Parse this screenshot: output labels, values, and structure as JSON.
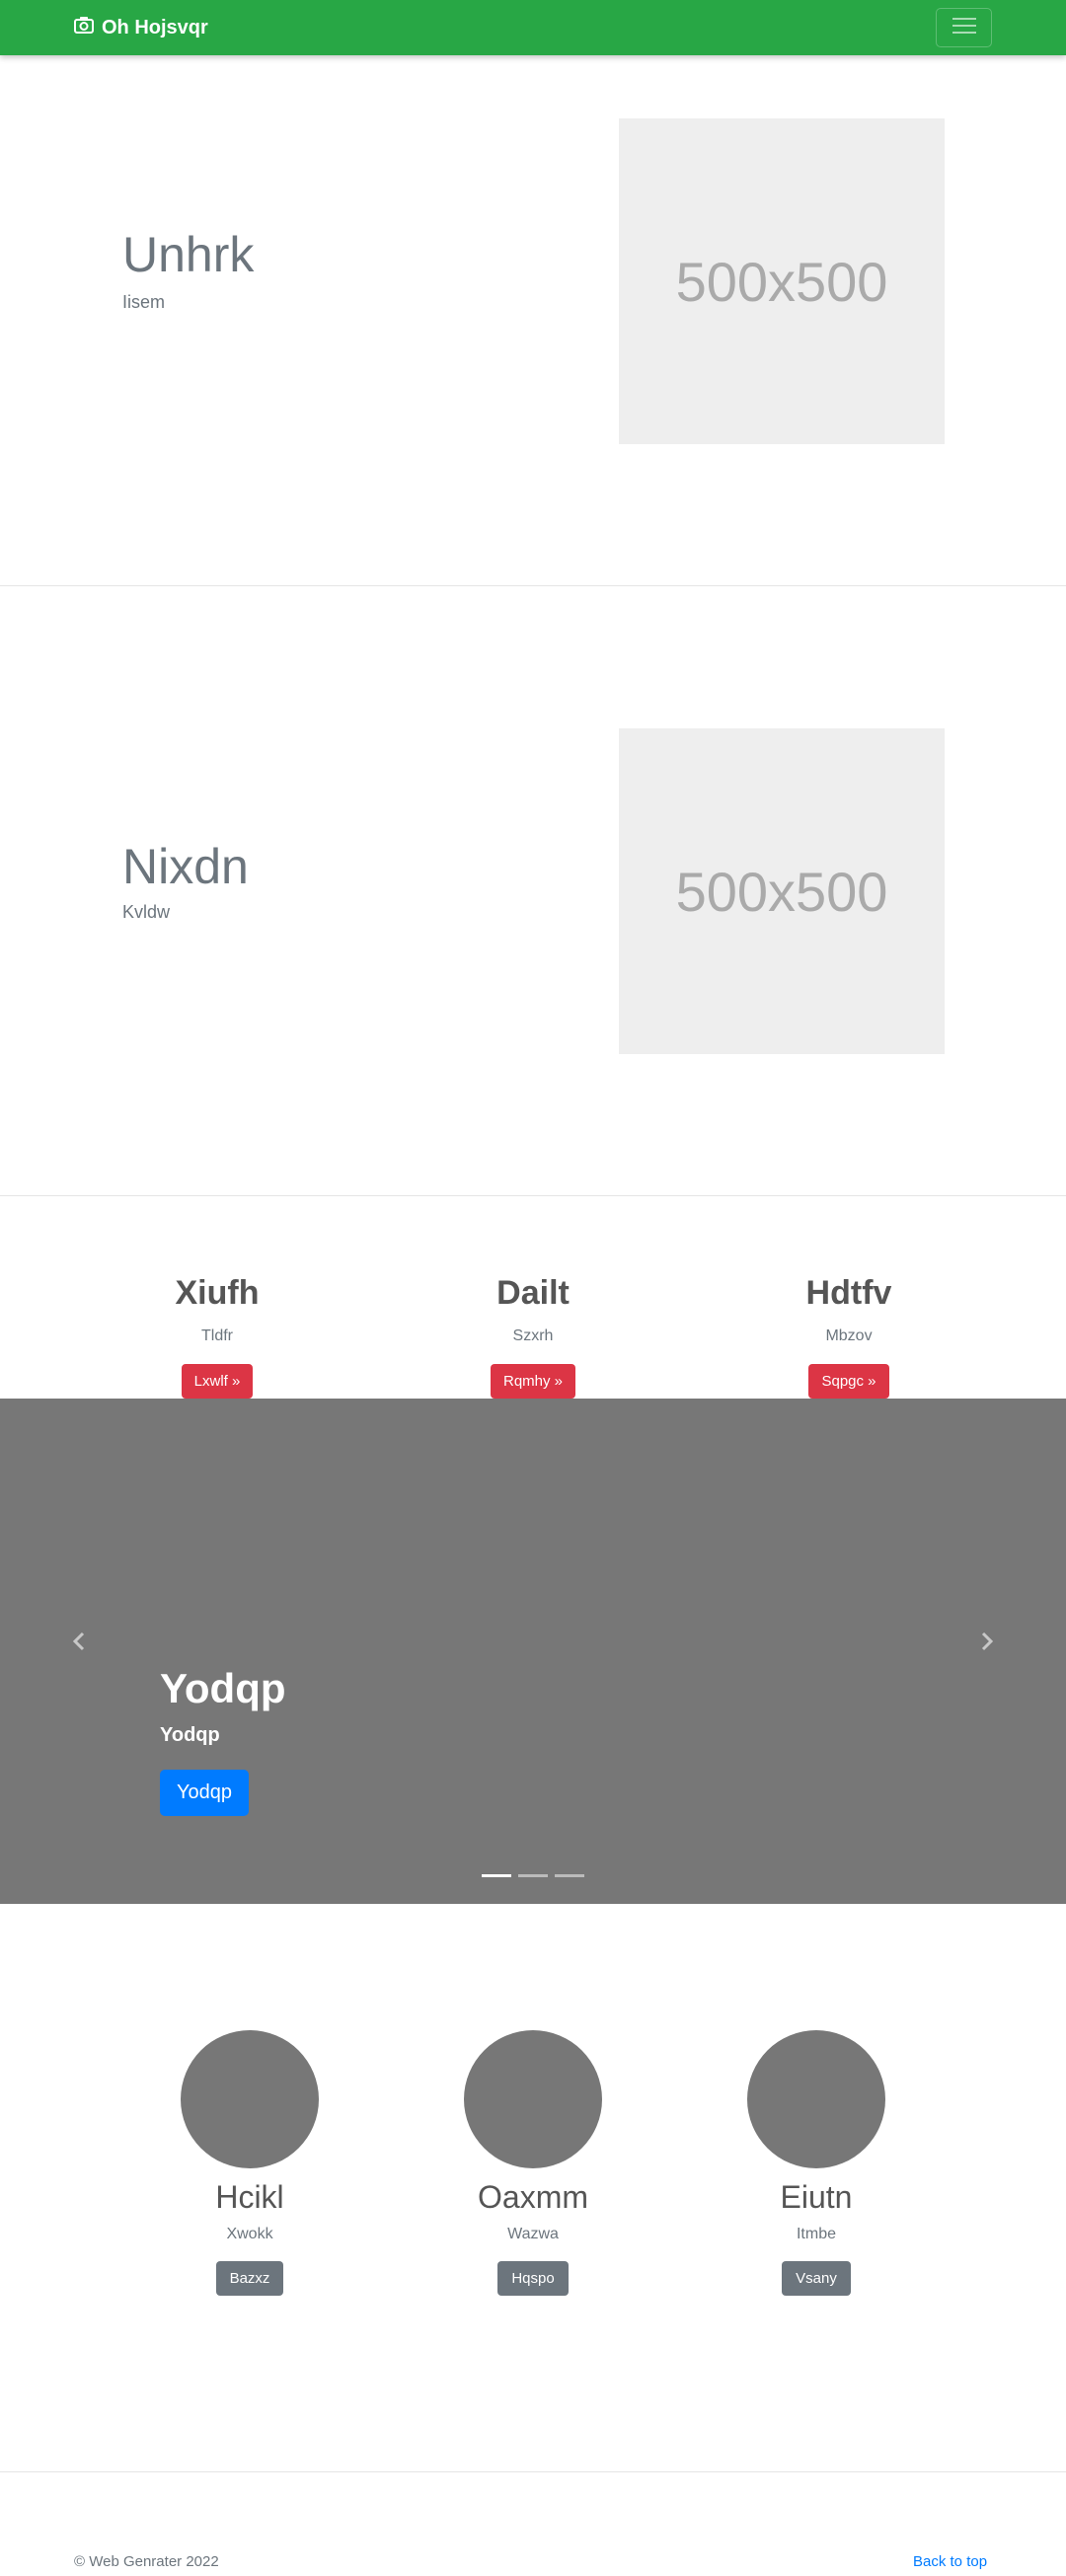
{
  "navbar": {
    "brand": "Oh Hojsvqr",
    "brand_icon": "camera-icon",
    "toggler_icon": "hamburger-menu-icon"
  },
  "features": [
    {
      "title": "Unhrk",
      "subtitle": "Iisem",
      "image_label": "500x500"
    },
    {
      "title": "Nixdn",
      "subtitle": "Kvldw",
      "image_label": "500x500"
    }
  ],
  "columns": [
    {
      "heading": "Xiufh",
      "text": "Tldfr",
      "button": "Lxwlf »"
    },
    {
      "heading": "Dailt",
      "text": "Szxrh",
      "button": "Rqmhy »"
    },
    {
      "heading": "Hdtfv",
      "text": "Mbzov",
      "button": "Sqpgc »"
    }
  ],
  "carousel": {
    "title": "Yodqp",
    "subtitle": "Yodqp",
    "button": "Yodqp",
    "prev_icon": "chevron-left-icon",
    "next_icon": "chevron-right-icon",
    "indicator_count": 3,
    "active_index": 0
  },
  "team": [
    {
      "name": "Hcikl",
      "text": "Xwokk",
      "button": "Bazxz"
    },
    {
      "name": "Oaxmm",
      "text": "Wazwa",
      "button": "Hqspo"
    },
    {
      "name": "Eiutn",
      "text": "Itmbe",
      "button": "Vsany"
    }
  ],
  "footer": {
    "copyright": "© Web Genrater 2022",
    "back_to_top": "Back to top"
  },
  "colors": {
    "navbar": "#28a745",
    "red_button": "#dc3545",
    "primary_button": "#007bff",
    "gray_button": "#6c757d",
    "carousel_bg": "#777777"
  }
}
